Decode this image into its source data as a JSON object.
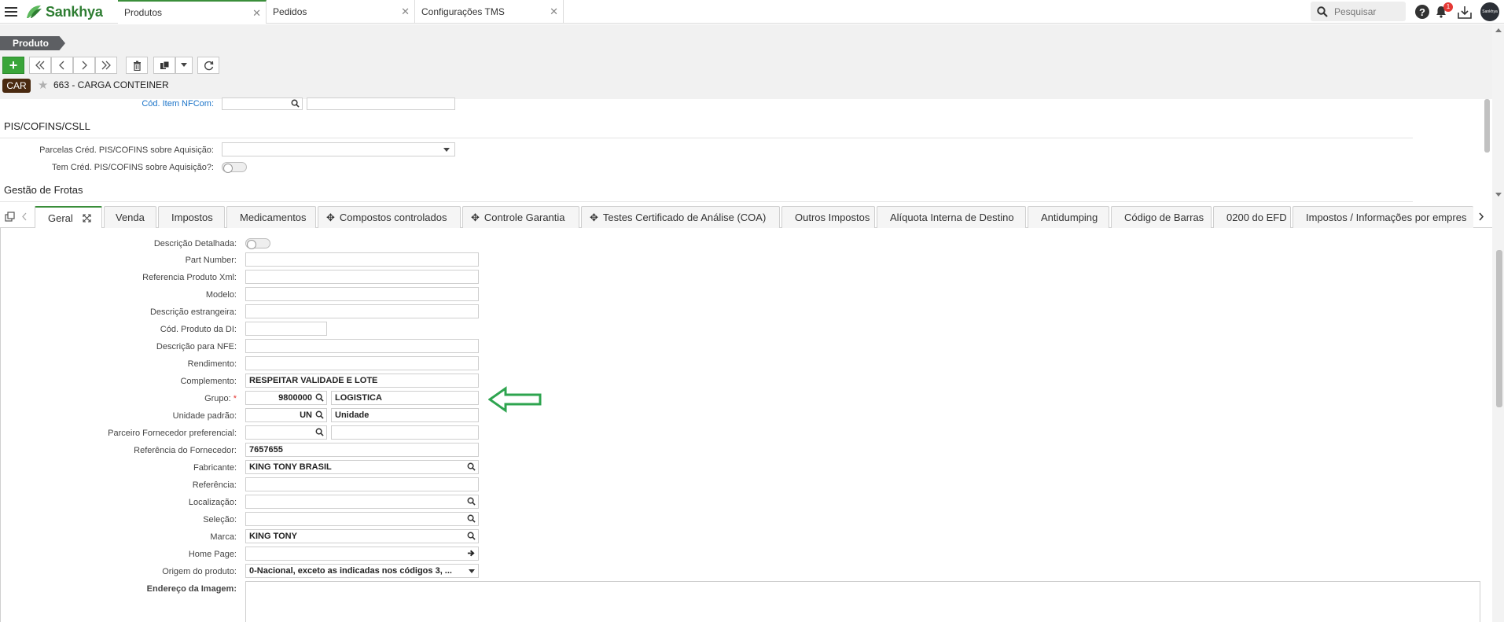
{
  "app": {
    "brand": "Sankhya",
    "tabs": [
      {
        "label": "Produtos"
      },
      {
        "label": "Pedidos"
      },
      {
        "label": "Configurações TMS"
      }
    ],
    "search_placeholder": "Pesquisar",
    "notification_count": "1",
    "avatar_text": "Sankhya"
  },
  "header": {
    "breadcrumb": "Produto",
    "record_badge": "CAR",
    "record_title": "663 - CARGA CONTEINER"
  },
  "upper": {
    "cod_item_nfcom_label": "Cód. Item NFCom:",
    "section_pis": "PIS/COFINS/CSLL",
    "parcelas_label": "Parcelas Créd. PIS/COFINS sobre Aquisição:",
    "tem_cred_label": "Tem Créd. PIS/COFINS sobre Aquisição?:",
    "section_frotas": "Gestão de Frotas"
  },
  "form_tabs": [
    {
      "label": "Geral"
    },
    {
      "label": "Venda"
    },
    {
      "label": "Impostos"
    },
    {
      "label": "Medicamentos"
    },
    {
      "label": "Compostos controlados"
    },
    {
      "label": "Controle Garantia"
    },
    {
      "label": "Testes Certificado de Análise (COA)"
    },
    {
      "label": "Outros Impostos"
    },
    {
      "label": "Alíquota Interna de Destino"
    },
    {
      "label": "Antidumping"
    },
    {
      "label": "Código de Barras"
    },
    {
      "label": "0200 do EFD"
    },
    {
      "label": "Impostos / Informações por empres"
    }
  ],
  "fields": {
    "descricao_detalhada": {
      "label": "Descrição Detalhada:"
    },
    "part_number": {
      "label": "Part Number:",
      "value": ""
    },
    "referencia_xml": {
      "label": "Referencia Produto Xml:",
      "value": ""
    },
    "modelo": {
      "label": "Modelo:",
      "value": ""
    },
    "descricao_estrangeira": {
      "label": "Descrição estrangeira:",
      "value": ""
    },
    "cod_produto_di": {
      "label": "Cód. Produto da DI:",
      "value": ""
    },
    "descricao_nfe": {
      "label": "Descrição para NFE:",
      "value": ""
    },
    "rendimento": {
      "label": "Rendimento:",
      "value": ""
    },
    "complemento": {
      "label": "Complemento:",
      "value": "RESPEITAR VALIDADE E LOTE"
    },
    "grupo": {
      "label": "Grupo:",
      "required": "*",
      "code": "9800000",
      "desc": "LOGISTICA"
    },
    "unidade": {
      "label": "Unidade padrão:",
      "code": "UN",
      "desc": "Unidade"
    },
    "parceiro": {
      "label": "Parceiro Fornecedor preferencial:",
      "code": "",
      "desc": ""
    },
    "ref_fornecedor": {
      "label": "Referência do Fornecedor:",
      "value": "7657655"
    },
    "fabricante": {
      "label": "Fabricante:",
      "value": "KING TONY BRASIL"
    },
    "referencia": {
      "label": "Referência:",
      "value": ""
    },
    "localizacao": {
      "label": "Localização:",
      "value": ""
    },
    "selecao": {
      "label": "Seleção:",
      "value": ""
    },
    "marca": {
      "label": "Marca:",
      "value": "KING TONY"
    },
    "home_page": {
      "label": "Home Page:",
      "value": ""
    },
    "origem": {
      "label": "Origem do produto:",
      "value": "0-Nacional, exceto as indicadas nos códigos 3, ..."
    },
    "endereco_imagem": {
      "label": "Endereço da Imagem:"
    }
  },
  "colors": {
    "accent_green": "#3aa53a",
    "link_blue": "#1a73c8",
    "arrow_green": "#2ea44f",
    "badge_brown": "#4a2a10"
  }
}
